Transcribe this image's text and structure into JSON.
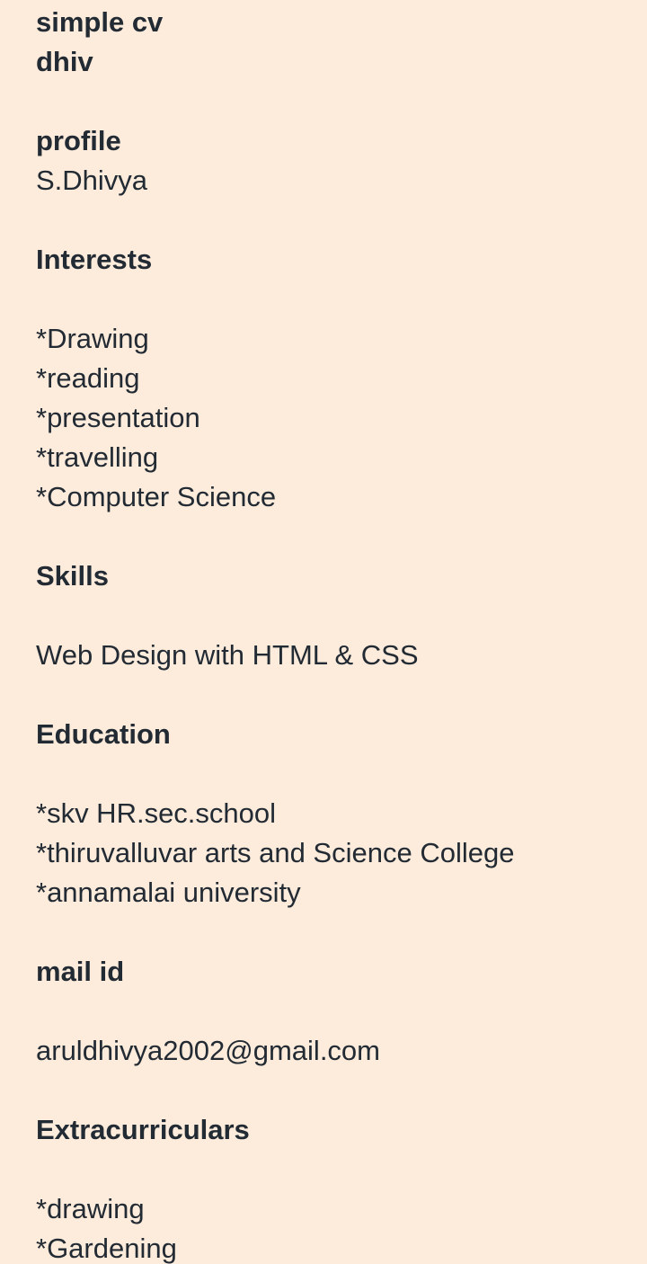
{
  "header": {
    "title": "simple cv",
    "subtitle": "dhiv"
  },
  "profile": {
    "heading": "profile",
    "name": "S.Dhivya"
  },
  "interests": {
    "heading": "Interests",
    "items": [
      "*Drawing",
      "*reading",
      "*presentation",
      "*travelling",
      "*Computer Science"
    ]
  },
  "skills": {
    "heading": "Skills",
    "items": [
      "Web Design with HTML & CSS"
    ]
  },
  "education": {
    "heading": "Education",
    "items": [
      "*skv HR.sec.school",
      "*thiruvalluvar arts and Science College",
      "*annamalai university"
    ]
  },
  "mail": {
    "heading": "mail id",
    "value": "aruldhivya2002@gmail.com"
  },
  "extracurriculars": {
    "heading": "Extracurriculars",
    "items": [
      "*drawing",
      "*Gardening"
    ]
  }
}
